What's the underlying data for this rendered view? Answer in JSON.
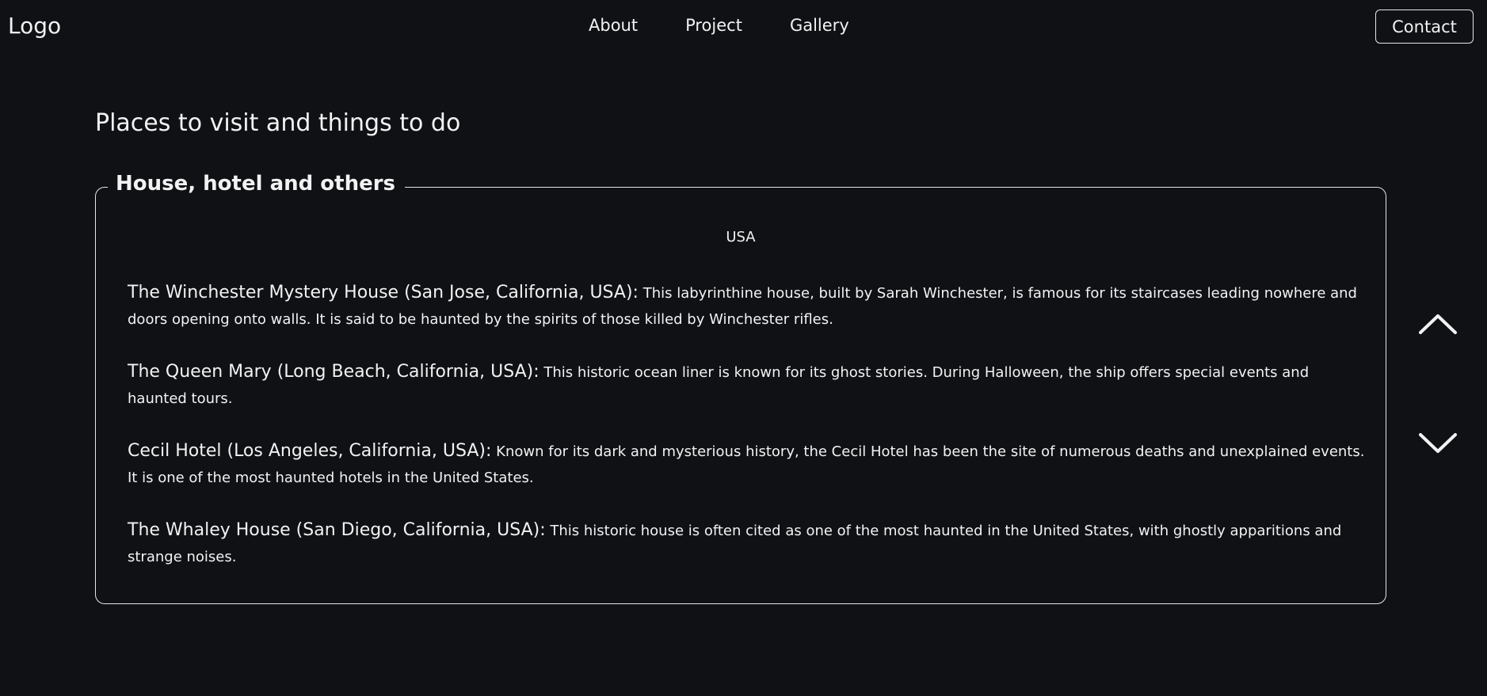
{
  "header": {
    "logo": "Logo",
    "nav": [
      "About",
      "Project",
      "Gallery"
    ],
    "contact_label": "Contact"
  },
  "main": {
    "title": "Places to visit and things to do",
    "panel": {
      "legend": "House, hotel and others",
      "region": "USA",
      "entries": [
        {
          "name": "The Winchester Mystery House (San Jose, California, USA):",
          "description": "This labyrinthine house, built by Sarah Winchester, is famous for its staircases leading nowhere and doors opening onto walls. It is said to be haunted by the spirits of those killed by Winchester rifles."
        },
        {
          "name": "The Queen Mary (Long Beach, California, USA):",
          "description": "This historic ocean liner is known for its ghost stories. During Halloween, the ship offers special events and haunted tours."
        },
        {
          "name": "Cecil Hotel (Los Angeles, California, USA):",
          "description": "Known for its dark and mysterious history, the Cecil Hotel has been the site of numerous deaths and unexplained events. It is one of the most haunted hotels in the United States."
        },
        {
          "name": "The Whaley House (San Diego, California, USA):",
          "description": "This historic house is often cited as one of the most haunted in the United States, with ghostly apparitions and strange noises."
        }
      ]
    }
  },
  "controls": {
    "up_icon": "chevron-up-icon",
    "down_icon": "chevron-down-icon"
  },
  "colors": {
    "background": "#0f1115",
    "text": "#f2f2f2",
    "border": "#e6e6e6"
  }
}
